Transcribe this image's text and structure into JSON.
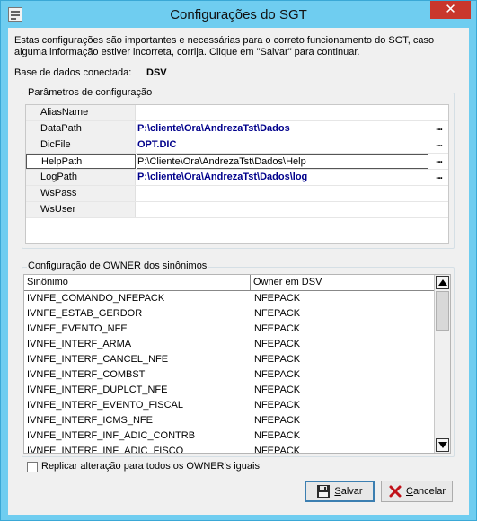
{
  "window": {
    "title": "Configurações do SGT",
    "close_glyph": "✕"
  },
  "intro_text": "Estas configurações são importantes e necessárias para o correto funcionamento do SGT, caso alguma informação estiver incorreta, corrija. Clique em \"Salvar\" para continuar.",
  "database": {
    "label": "Base de dados conectada:",
    "value": "DSV"
  },
  "params": {
    "title": "Parâmetros de configuração",
    "ellipsis": "...",
    "rows": [
      {
        "name": "AliasName",
        "value": ""
      },
      {
        "name": "DataPath",
        "value": "P:\\cliente\\Ora\\AndrezaTst\\Dados"
      },
      {
        "name": "DicFile",
        "value": "OPT.DIC"
      },
      {
        "name": "HelpPath",
        "value": "P:\\Cliente\\Ora\\AndrezaTst\\Dados\\Help"
      },
      {
        "name": "LogPath",
        "value": "P:\\cliente\\Ora\\AndrezaTst\\Dados\\log"
      },
      {
        "name": "WsPass",
        "value": ""
      },
      {
        "name": "WsUser",
        "value": ""
      }
    ]
  },
  "owners": {
    "title": "Configuração de OWNER dos sinônimos",
    "col_synonym": "Sinônimo",
    "col_owner": "Owner em DSV",
    "rows": [
      {
        "syn": "IVNFE_COMANDO_NFEPACK",
        "owner": "NFEPACK"
      },
      {
        "syn": "IVNFE_ESTAB_GERDOR",
        "owner": "NFEPACK"
      },
      {
        "syn": "IVNFE_EVENTO_NFE",
        "owner": "NFEPACK"
      },
      {
        "syn": "IVNFE_INTERF_ARMA",
        "owner": "NFEPACK"
      },
      {
        "syn": "IVNFE_INTERF_CANCEL_NFE",
        "owner": "NFEPACK"
      },
      {
        "syn": "IVNFE_INTERF_COMBST",
        "owner": "NFEPACK"
      },
      {
        "syn": "IVNFE_INTERF_DUPLCT_NFE",
        "owner": "NFEPACK"
      },
      {
        "syn": "IVNFE_INTERF_EVENTO_FISCAL",
        "owner": "NFEPACK"
      },
      {
        "syn": "IVNFE_INTERF_ICMS_NFE",
        "owner": "NFEPACK"
      },
      {
        "syn": "IVNFE_INTERF_INF_ADIC_CONTRB",
        "owner": "NFEPACK"
      },
      {
        "syn": "IVNFE_INTERF_INF_ADIC_FISCO",
        "owner": "NFEPACK"
      }
    ]
  },
  "replicate_label": "Replicar alteração para todos os OWNER's iguais",
  "buttons": {
    "save_first": "S",
    "save_rest": "alvar",
    "cancel_first": "C",
    "cancel_rest": "ancelar"
  },
  "colors": {
    "title_bar": "#6fcdf0",
    "close_button": "#c9372c",
    "bold_value": "#00008b"
  }
}
